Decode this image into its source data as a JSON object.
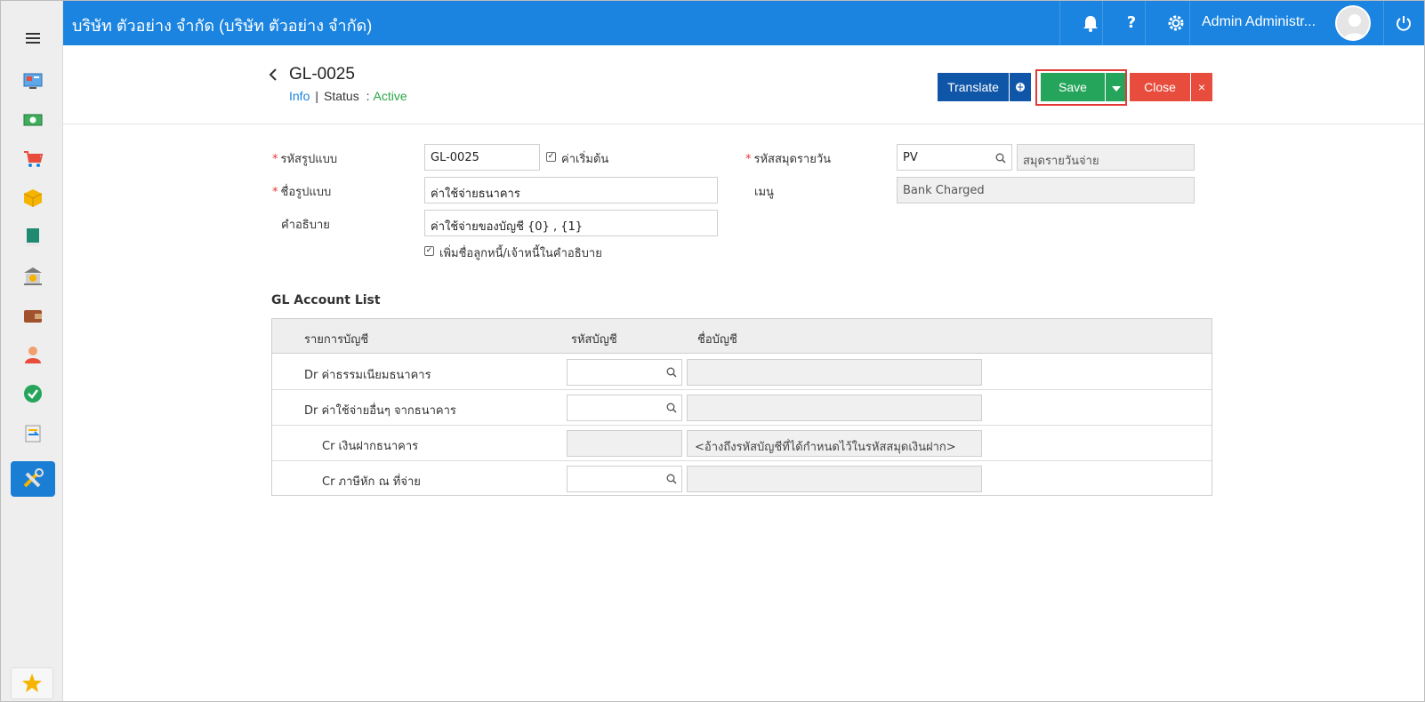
{
  "header": {
    "company": "บริษัท ตัวอย่าง จำกัด (บริษัท ตัวอย่าง จำกัด)",
    "user": "Admin Administr...",
    "help": "?"
  },
  "page": {
    "doc_code": "GL-0025",
    "info_tab": "Info",
    "status_label": "Status",
    "status_colon": ":",
    "status_value": "Active",
    "separator": "|"
  },
  "actions": {
    "translate": "Translate",
    "save": "Save",
    "close": "Close",
    "close_x": "×"
  },
  "form": {
    "code_label": "รหัสรูปแบบ",
    "code_value": "GL-0025",
    "default_label": "ค่าเริ่มต้น",
    "name_label": "ชื่อรูปแบบ",
    "name_value": "ค่าใช้จ่ายธนาคาร",
    "desc_label": "คำอธิบาย",
    "desc_value": "ค่าใช้จ่ายของบัญชี {0} , {1}",
    "add_name_label": "เพิ่มชื่อลูกหนี้/เจ้าหนี้ในคำอธิบาย",
    "journal_label": "รหัสสมุดรายวัน",
    "journal_value": "PV",
    "journal_name": "สมุดรายวันจ่าย",
    "menu_label": "เมนู",
    "menu_value": "Bank Charged",
    "required_mark": "*"
  },
  "gl_list": {
    "title": "GL Account List",
    "columns": [
      "รายการบัญชี",
      "รหัสบัญชี",
      "ชื่อบัญชี"
    ],
    "rows": [
      {
        "item": "Dr ค่าธรรมเนียมธนาคาร",
        "code": "",
        "name": ""
      },
      {
        "item": "Dr ค่าใช้จ่ายอื่นๆ จากธนาคาร",
        "code": "",
        "name": ""
      },
      {
        "item": "Cr เงินฝากธนาคาร",
        "code": "",
        "name": "<อ้างถึงรหัสบัญชีที่ได้กำหนดไว้ในรหัสสมุดเงินฝาก>"
      },
      {
        "item": "Cr ภาษีหัก ณ ที่จ่าย",
        "code": "",
        "name": ""
      }
    ]
  },
  "colors": {
    "topbar": "#1a84e0",
    "translate": "#0f56a8",
    "save": "#25a55b",
    "close": "#e74c3c",
    "sidebar_active": "#1a7fd4"
  }
}
